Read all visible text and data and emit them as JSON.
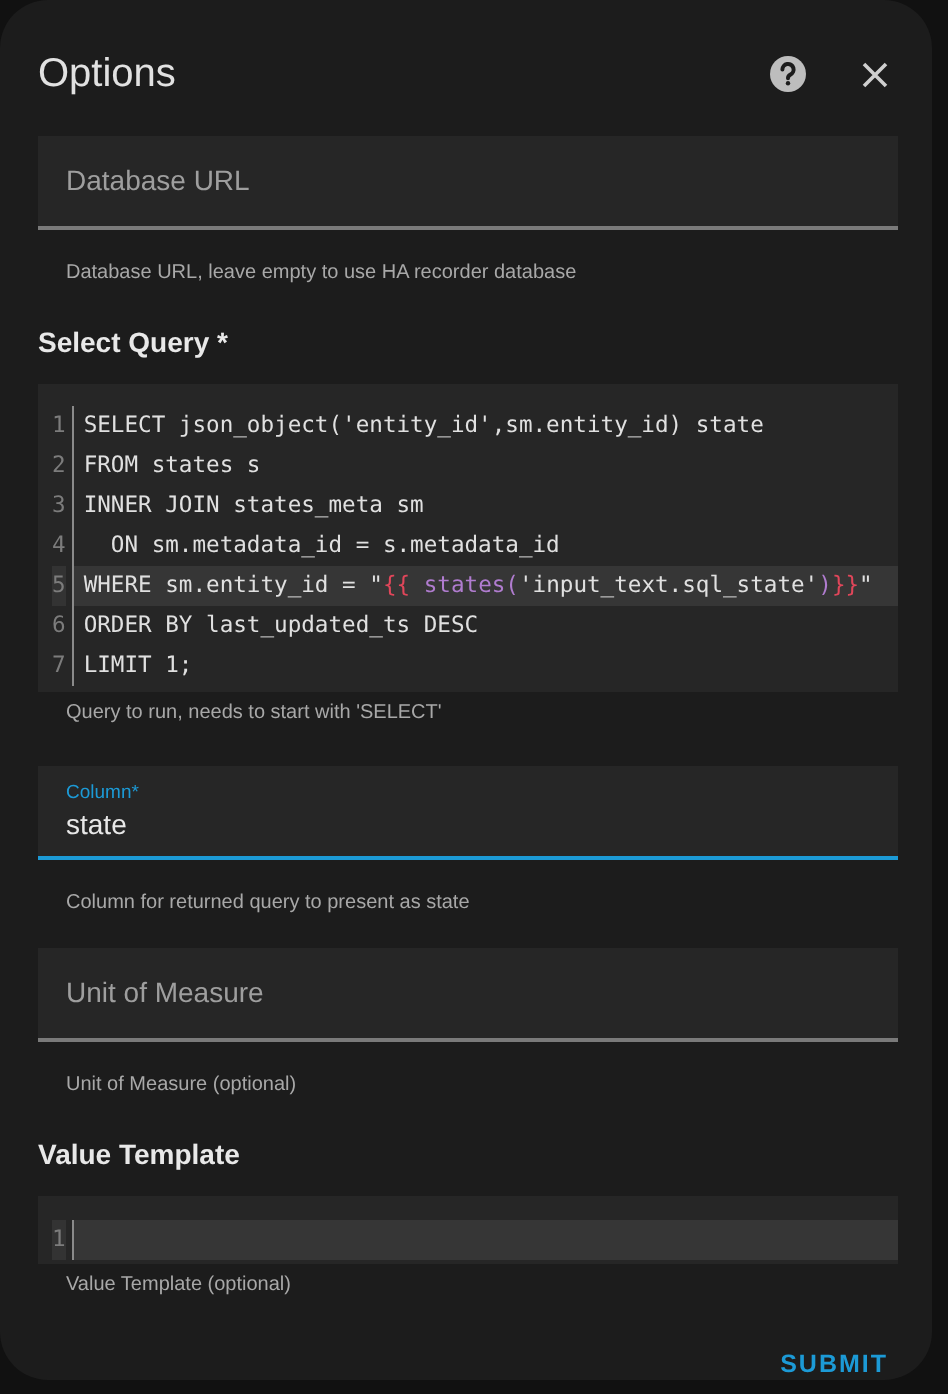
{
  "dialog": {
    "title": "Options"
  },
  "items": [
    {
      "kind": "text_field",
      "label": "Database URL",
      "value": "",
      "focused": false
    },
    {
      "kind": "helper",
      "text": "Database URL, leave empty to use HA recorder database"
    },
    {
      "kind": "heading",
      "text": "Select Query *"
    },
    {
      "kind": "code_editor",
      "lines": [
        {
          "number": "1",
          "active": false,
          "segments": [
            {
              "text": "SELECT json_object('entity_id',sm.entity_id) state",
              "color": "#e0e0e0"
            }
          ]
        },
        {
          "number": "2",
          "active": false,
          "segments": [
            {
              "text": "FROM states s",
              "color": "#e0e0e0"
            }
          ]
        },
        {
          "number": "3",
          "active": false,
          "segments": [
            {
              "text": "INNER JOIN states_meta sm",
              "color": "#e0e0e0"
            }
          ]
        },
        {
          "number": "4",
          "active": false,
          "segments": [
            {
              "text": "  ON sm.metadata_id = s.metadata_id",
              "color": "#e0e0e0"
            }
          ]
        },
        {
          "number": "5",
          "active": true,
          "segments": [
            {
              "text": "WHERE sm.entity_id = \"",
              "color": "#e0e0e0"
            },
            {
              "text": "{{",
              "color": "#e0465a"
            },
            {
              "text": " states(",
              "color": "#b07ccf"
            },
            {
              "text": "'input_text.sql_state'",
              "color": "#e0e0e0"
            },
            {
              "text": ")",
              "color": "#b07ccf"
            },
            {
              "text": "}}",
              "color": "#e0465a"
            },
            {
              "text": "\"",
              "color": "#e0e0e0"
            }
          ]
        },
        {
          "number": "6",
          "active": false,
          "segments": [
            {
              "text": "ORDER BY last_updated_ts DESC",
              "color": "#e0e0e0"
            }
          ]
        },
        {
          "number": "7",
          "active": false,
          "segments": [
            {
              "text": "LIMIT 1;",
              "color": "#e0e0e0"
            }
          ]
        }
      ]
    },
    {
      "kind": "helper",
      "text": "Query to run, needs to start with 'SELECT'"
    },
    {
      "kind": "text_field",
      "label": "Column*",
      "value": "state",
      "focused": true
    },
    {
      "kind": "helper",
      "text": "Column for returned query to present as state"
    },
    {
      "kind": "text_field",
      "label": "Unit of Measure",
      "value": "",
      "focused": false
    },
    {
      "kind": "helper",
      "text": "Unit of Measure (optional)"
    },
    {
      "kind": "heading",
      "text": "Value Template"
    },
    {
      "kind": "code_editor",
      "lines": [
        {
          "number": "1",
          "active": true
        }
      ]
    },
    {
      "kind": "helper",
      "text": "Value Template (optional)"
    }
  ],
  "submit": "SUBMIT"
}
